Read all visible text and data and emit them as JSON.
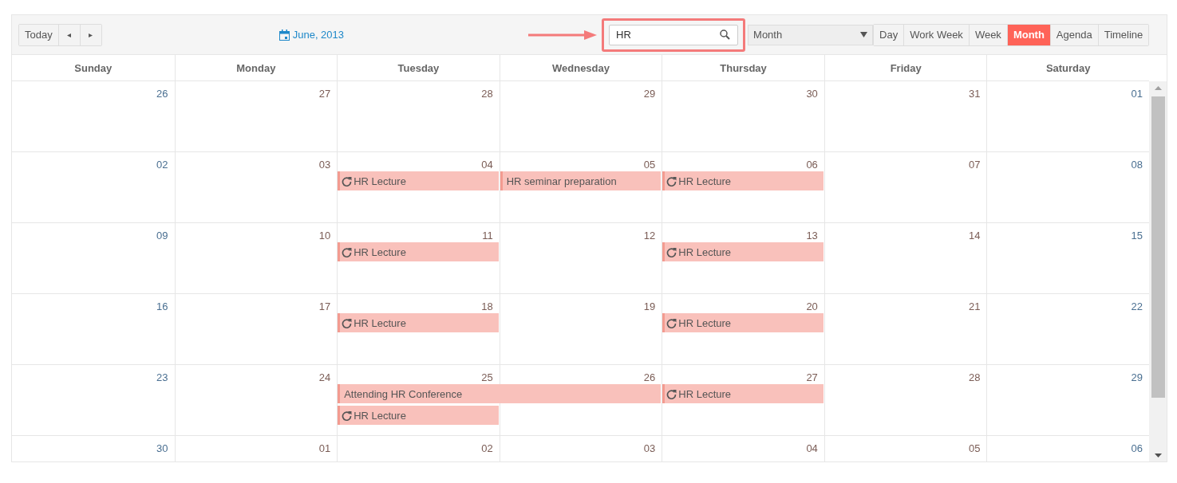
{
  "toolbar": {
    "today_button": "Today",
    "prev_button": "◂",
    "next_button": "▸",
    "date_range": "June, 2013",
    "search": {
      "value": "HR"
    },
    "view_dropdown": {
      "value": "Month"
    },
    "views": [
      {
        "label": "Day",
        "selected": false
      },
      {
        "label": "Work Week",
        "selected": false
      },
      {
        "label": "Week",
        "selected": false
      },
      {
        "label": "Month",
        "selected": true
      },
      {
        "label": "Agenda",
        "selected": false
      },
      {
        "label": "Timeline",
        "selected": false
      }
    ]
  },
  "weekday_headers": [
    "Sunday",
    "Monday",
    "Tuesday",
    "Wednesday",
    "Thursday",
    "Friday",
    "Saturday"
  ],
  "weeks": [
    {
      "days": [
        {
          "number": "26"
        },
        {
          "number": "27"
        },
        {
          "number": "28"
        },
        {
          "number": "29"
        },
        {
          "number": "30"
        },
        {
          "number": "31"
        },
        {
          "number": "01"
        }
      ]
    },
    {
      "days": [
        {
          "number": "02"
        },
        {
          "number": "03"
        },
        {
          "number": "04",
          "events": [
            {
              "title": "HR Lecture",
              "recurring": true,
              "continues": false
            }
          ]
        },
        {
          "number": "05",
          "events": [
            {
              "title": "HR seminar preparation",
              "recurring": false,
              "continues": false
            }
          ]
        },
        {
          "number": "06",
          "events": [
            {
              "title": "HR Lecture",
              "recurring": true,
              "continues": false
            }
          ]
        },
        {
          "number": "07"
        },
        {
          "number": "08"
        }
      ]
    },
    {
      "days": [
        {
          "number": "09"
        },
        {
          "number": "10"
        },
        {
          "number": "11",
          "events": [
            {
              "title": "HR Lecture",
              "recurring": true,
              "continues": false
            }
          ]
        },
        {
          "number": "12"
        },
        {
          "number": "13",
          "events": [
            {
              "title": "HR Lecture",
              "recurring": true,
              "continues": false
            }
          ]
        },
        {
          "number": "14"
        },
        {
          "number": "15"
        }
      ]
    },
    {
      "days": [
        {
          "number": "16"
        },
        {
          "number": "17"
        },
        {
          "number": "18",
          "events": [
            {
              "title": "HR Lecture",
              "recurring": true,
              "continues": false
            }
          ]
        },
        {
          "number": "19"
        },
        {
          "number": "20",
          "events": [
            {
              "title": "HR Lecture",
              "recurring": true,
              "continues": false
            }
          ]
        },
        {
          "number": "21"
        },
        {
          "number": "22"
        }
      ]
    },
    {
      "days": [
        {
          "number": "23"
        },
        {
          "number": "24"
        },
        {
          "number": "25",
          "events": [
            {
              "title": "Attending HR Conference",
              "recurring": false,
              "continues": true
            },
            {
              "title": "HR Lecture",
              "recurring": true,
              "continues": false
            }
          ]
        },
        {
          "number": "26"
        },
        {
          "number": "27",
          "events": [
            {
              "title": "HR Lecture",
              "recurring": true,
              "continues": false
            }
          ]
        },
        {
          "number": "28"
        },
        {
          "number": "29"
        }
      ]
    },
    {
      "days": [
        {
          "number": "30"
        },
        {
          "number": "01"
        },
        {
          "number": "02"
        },
        {
          "number": "03"
        },
        {
          "number": "04"
        },
        {
          "number": "05"
        },
        {
          "number": "06"
        }
      ]
    }
  ]
}
